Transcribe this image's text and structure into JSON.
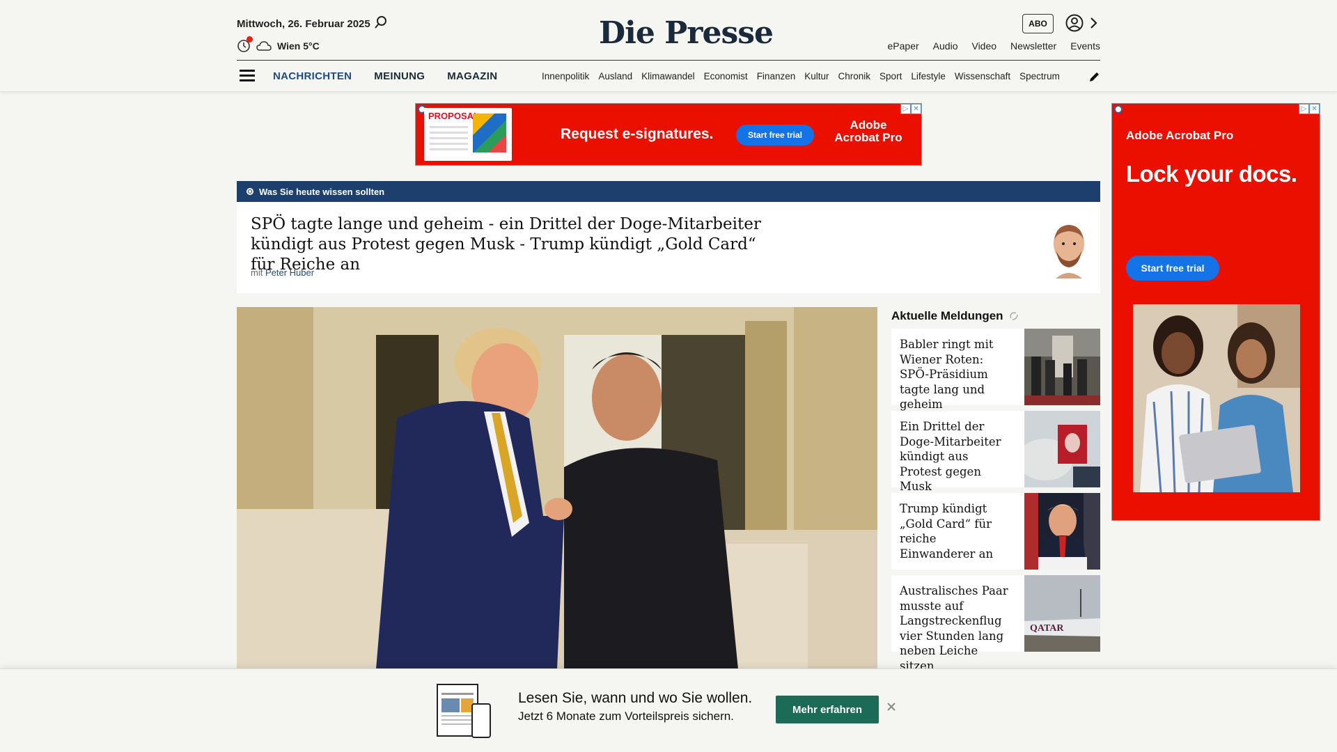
{
  "header": {
    "date": "Mittwoch, 26. Februar 2025",
    "weather": "Wien 5°C",
    "logo": "Die Presse",
    "abo_label": "ABO",
    "top_links": [
      "ePaper",
      "Audio",
      "Video",
      "Newsletter",
      "Events"
    ],
    "main_nav": [
      "NACHRICHTEN",
      "MEINUNG",
      "MAGAZIN"
    ],
    "sub_nav": [
      "Innenpolitik",
      "Ausland",
      "Klimawandel",
      "Economist",
      "Finanzen",
      "Kultur",
      "Chronik",
      "Sport",
      "Lifestyle",
      "Wissenschaft",
      "Spectrum"
    ]
  },
  "ad_banner": {
    "thumb_label": "PROPOSAL",
    "headline": "Request e-signatures.",
    "button": "Start free trial",
    "brand": "Adobe Acrobat Pro"
  },
  "ad_side": {
    "brand": "Adobe Acrobat Pro",
    "headline": "Lock your docs.",
    "button": "Start free trial"
  },
  "briefing": {
    "bar_label": "Was Sie heute wissen sollten",
    "title": "SPÖ tagte lange und geheim - ein Drittel der Doge-Mitarbeiter kündigt aus Protest gegen Musk - Trump kündigt „Gold Card“ für Reiche an",
    "by_prefix": "mit",
    "author": "Peter Huber"
  },
  "news": {
    "title": "Aktuelle Meldungen",
    "items": [
      {
        "text": "Babler ringt mit Wiener Roten: SPÖ-Präsidium tagte lang und geheim"
      },
      {
        "text": "Ein Drittel der Doge-Mitarbeiter kündigt aus Protest gegen Musk"
      },
      {
        "text": "Trump kündigt „Gold Card“ für reiche Einwanderer an"
      },
      {
        "text": "Australisches Paar musste auf Langstreckenflug vier Stunden lang neben Leiche sitzen"
      }
    ]
  },
  "bottom_bar": {
    "line1": "Lesen Sie, wann und wo Sie wollen.",
    "line2": "Jetzt 6 Monate zum Vorteilspreis sichern.",
    "button": "Mehr erfahren"
  },
  "colors": {
    "brand_blue": "#1c3f6e",
    "adobe_red": "#eb0f00",
    "cta_green": "#1b6b57",
    "link_blue": "#1e4b80"
  }
}
